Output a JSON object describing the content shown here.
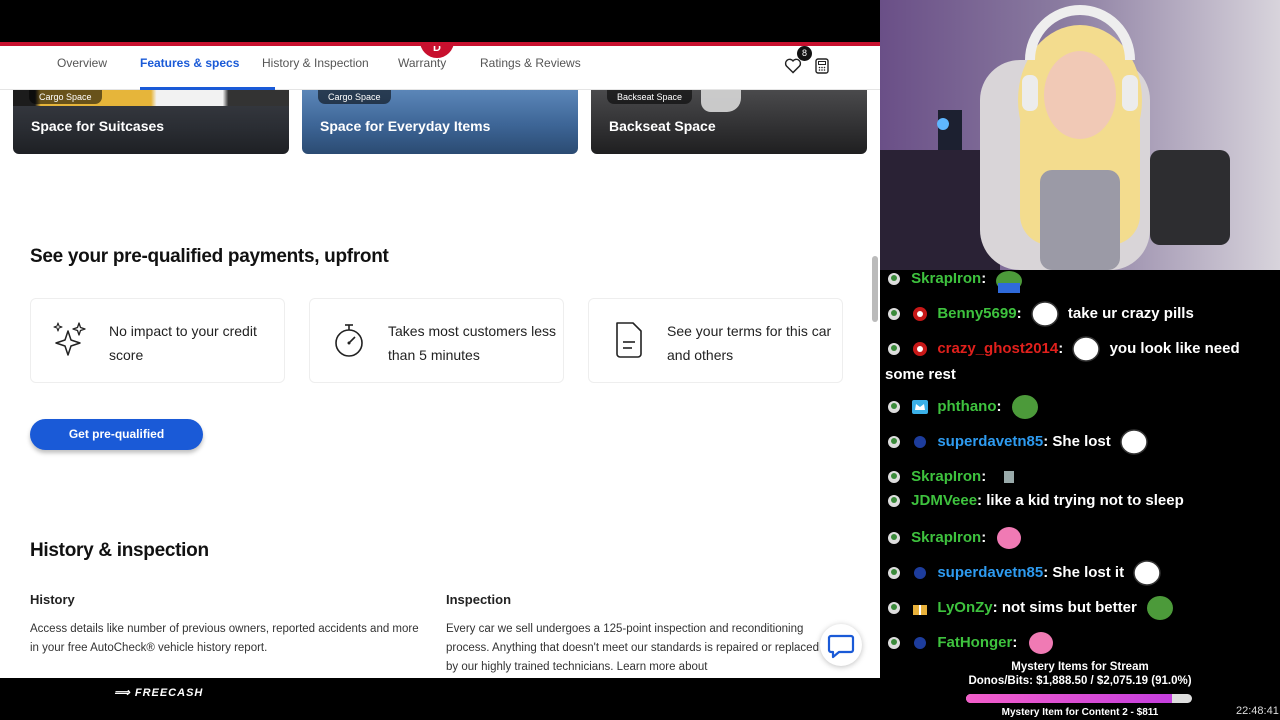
{
  "site": {
    "nav": {
      "tabs": [
        "Overview",
        "Features & specs",
        "History & Inspection",
        "Warranty",
        "Ratings & Reviews"
      ],
      "active_tab": "Features & specs",
      "favorites_count": "8"
    },
    "cards": [
      {
        "tag": "Cargo Space",
        "title": "Space for Suitcases"
      },
      {
        "tag": "Cargo Space",
        "title": "Space for Everyday Items"
      },
      {
        "tag": "Backseat Space",
        "title": "Backseat Space"
      }
    ],
    "prequal": {
      "title": "See your pre-qualified payments, upfront",
      "items": [
        {
          "icon": "sparkle-icon",
          "text": "No impact to your credit score"
        },
        {
          "icon": "stopwatch-icon",
          "text": "Takes most customers less than 5 minutes"
        },
        {
          "icon": "document-icon",
          "text": "See your terms for this car and others"
        }
      ],
      "button": "Get pre-qualified"
    },
    "history": {
      "title": "History & inspection",
      "history_heading": "History",
      "history_body": "Access details like number of previous owners, reported accidents and more in your free AutoCheck® vehicle history report.",
      "inspection_heading": "Inspection",
      "inspection_body": "Every car we sell undergoes a 125-point inspection and reconditioning process. Anything that doesn't meet our standards is repaired or replaced by our highly trained technicians. Learn more about"
    }
  },
  "banner": {
    "freecash": "FREECASH"
  },
  "chat": {
    "messages": [
      {
        "user": "SkrapIron",
        "color": "#3ec23e",
        "text": ""
      },
      {
        "user": "Benny5699",
        "color": "#3ec23e",
        "text": "take ur crazy pills"
      },
      {
        "user": "crazy_ghost2014",
        "color": "#e0201c",
        "text": "you look like need some rest"
      },
      {
        "user": "phthano",
        "color": "#3ec23e",
        "text": ""
      },
      {
        "user": "superdavetn85",
        "color": "#2e9bf0",
        "text": "She lost"
      },
      {
        "user": "SkrapIron",
        "color": "#3ec23e",
        "text": ""
      },
      {
        "user": "JDMVeee",
        "color": "#3ec23e",
        "text": "like a kid trying not to sleep"
      },
      {
        "user": "SkrapIron",
        "color": "#3ec23e",
        "text": ""
      },
      {
        "user": "superdavetn85",
        "color": "#2e9bf0",
        "text": "She lost it"
      },
      {
        "user": "LyOnZy",
        "color": "#3ec23e",
        "text": "not sims but better"
      },
      {
        "user": "FatHonger",
        "color": "#3ec23e",
        "text": ""
      }
    ]
  },
  "donos": {
    "line1": "Mystery Items for Stream",
    "line2": "Donos/Bits: $1,888.50 / $2,075.19 (91.0%)",
    "progress": 0.91,
    "line3": "Mystery Item for Content 2 - $811"
  },
  "clock": "22:48:41"
}
